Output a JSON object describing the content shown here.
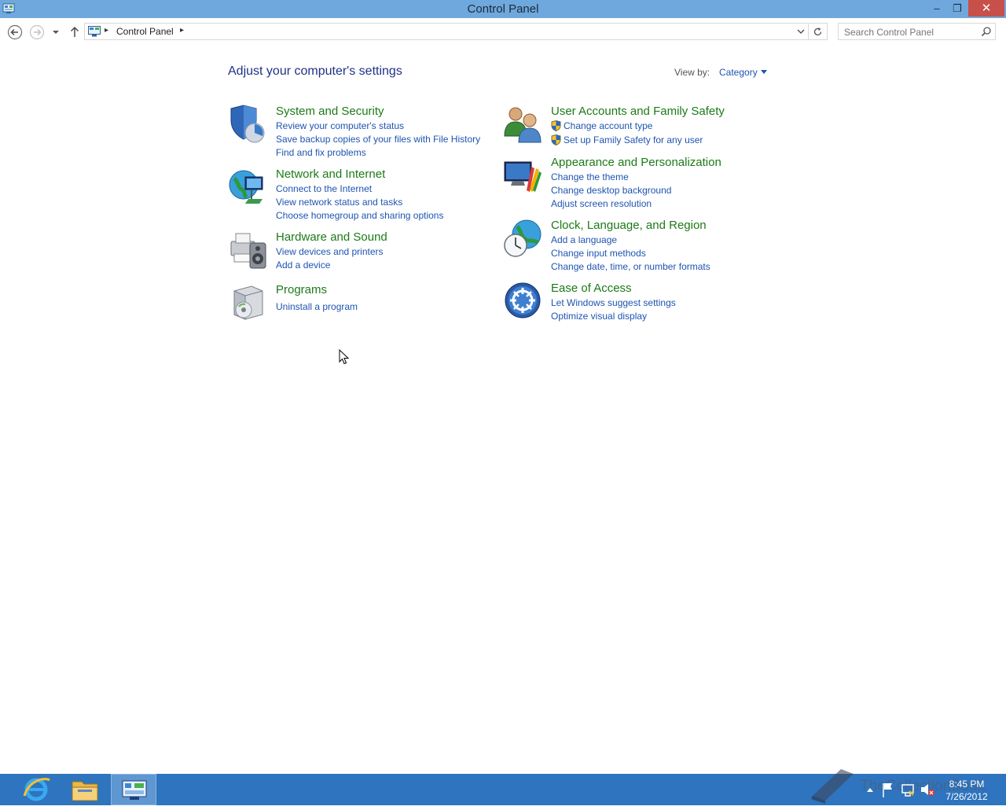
{
  "window": {
    "title": "Control Panel",
    "minimize_glyph": "–",
    "restore_glyph": "❐",
    "close_glyph": "✕"
  },
  "address": {
    "crumb": "Control Panel",
    "separator": "▸",
    "dropdown_glyph": "⌵"
  },
  "search": {
    "placeholder": "Search Control Panel"
  },
  "main": {
    "title": "Adjust your computer's settings",
    "view_by_label": "View by:",
    "view_by_value": "Category"
  },
  "categories": {
    "system": {
      "title": "System and Security",
      "links": [
        "Review your computer's status",
        "Save backup copies of your files with File History",
        "Find and fix problems"
      ]
    },
    "network": {
      "title": "Network and Internet",
      "links": [
        "Connect to the Internet",
        "View network status and tasks",
        "Choose homegroup and sharing options"
      ]
    },
    "hardware": {
      "title": "Hardware and Sound",
      "links": [
        "View devices and printers",
        "Add a device"
      ]
    },
    "programs": {
      "title": "Programs",
      "links": [
        "Uninstall a program"
      ]
    },
    "users": {
      "title": "User Accounts and Family Safety",
      "links": [
        "Change account type",
        "Set up Family Safety for any user"
      ]
    },
    "appearance": {
      "title": "Appearance and Personalization",
      "links": [
        "Change the theme",
        "Change desktop background",
        "Adjust screen resolution"
      ]
    },
    "clock": {
      "title": "Clock, Language, and Region",
      "links": [
        "Add a language",
        "Change input methods",
        "Change date, time, or number formats"
      ]
    },
    "ease": {
      "title": "Ease of Access",
      "links": [
        "Let Windows suggest settings",
        "Optimize visual display"
      ]
    }
  },
  "taskbar": {
    "time": "8:45 PM",
    "date": "7/26/2012",
    "watermark": "TheCollectionBook"
  },
  "colors": {
    "titlebar": "#6fa8dc",
    "taskbar": "#2e74be",
    "heading_green": "#1c7a17",
    "link_blue": "#1e54b1",
    "close_red": "#c7504a"
  }
}
